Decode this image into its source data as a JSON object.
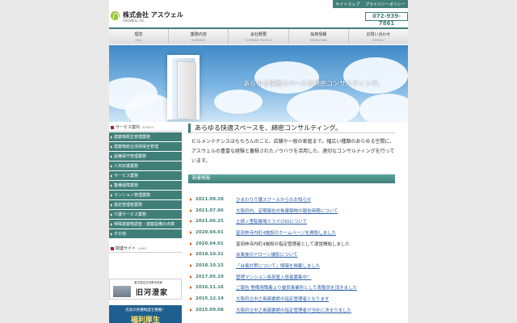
{
  "topbar": {
    "links": [
      "サイトマップ",
      "プライバシーポリシー"
    ]
  },
  "header": {
    "company_name": "株式会社 アスウェル",
    "company_name_en": "ASUWELL Inc.",
    "phone": "072-939-7861"
  },
  "nav": [
    {
      "label": "理念",
      "sub": "IDEA"
    },
    {
      "label": "業務内容",
      "sub": "BUSINESS"
    },
    {
      "label": "会社概要",
      "sub": "COMPANY PROFILE"
    },
    {
      "label": "採用情報",
      "sub": "RECRUITING"
    },
    {
      "label": "お問い合わせ",
      "sub": "CONTACT"
    }
  ],
  "hero": {
    "caption": "あらゆる快適スペースを綿密コンサルティング。"
  },
  "sidebar": {
    "service_heading": "サービス案内",
    "service_heading_en": "SERVICE",
    "items": [
      "建築物衛生管理業務",
      "建築物総合清掃保全管理",
      "設備保守管理業務",
      "人材派遣業務",
      "サービス業務",
      "警備保障業務",
      "マンション管理業務",
      "指定管理者業務",
      "介護サービス業務",
      "特殊建築物調査・建築設備の点検",
      "その他"
    ],
    "links_heading": "関連サイト",
    "links_heading_en": "LINKS",
    "banner1_sub": "重文指定日河原寺旧家",
    "banner1_main": "旧河澄家",
    "banner2_sub": "充実の各種制度を整備！",
    "banner2_main": "福利厚生"
  },
  "main": {
    "title": "あらゆる快適スペースを、綿密コンサルティング。",
    "intro": "ビルメンテナンスはもちろんのこと、店舗や一般の家庭まで。幅広い種類のあらゆる空間に、アスウェルの豊富な経験と蓄積されたノウハウを活用した、適切なコンサルティングを行っています。",
    "news_heading": "新着情報",
    "news": [
      {
        "date": "2021.09.28",
        "title": "ひまわり介護スクールからのお知らせ",
        "link": true
      },
      {
        "date": "2021.07.06",
        "title": "大阪府内、定期報告対象建築物の報告時期について",
        "link": true
      },
      {
        "date": "2021.06.25",
        "title": "土師ノ里駐輪場ミライロIDについて",
        "link": true
      },
      {
        "date": "2020.04.01",
        "title": "富田林寺内町4施設のホームページを開設しました",
        "link": true
      },
      {
        "date": "2020.04.01",
        "title": "富田林寺内町4施設の指定管理者として運営開始しました",
        "link": false
      },
      {
        "date": "2018.10.31",
        "title": "台風後のドローン撮影について",
        "link": true
      },
      {
        "date": "2018.10.15",
        "title": "「台風対策について」情報を掲載しました",
        "link": true
      },
      {
        "date": "2017.05.10",
        "title": "管理マンション各部屋入居者募集中！",
        "link": true
      },
      {
        "date": "2016.11.16",
        "title": "ご報告 警備現職着より優良事業所として表敬状を頂きました",
        "link": true
      },
      {
        "date": "2015.12.14",
        "title": "大阪府立中之島図書館の指定管理者となります",
        "link": true
      },
      {
        "date": "2015.09.08",
        "title": "大阪府立中之島図書館の指定管理者が当社に決まりました",
        "link": true
      }
    ]
  },
  "colors": {
    "accent": "#3f7f78",
    "date": "#3f7f78",
    "link": "#2c5fa8",
    "marker": "#b3162b"
  }
}
